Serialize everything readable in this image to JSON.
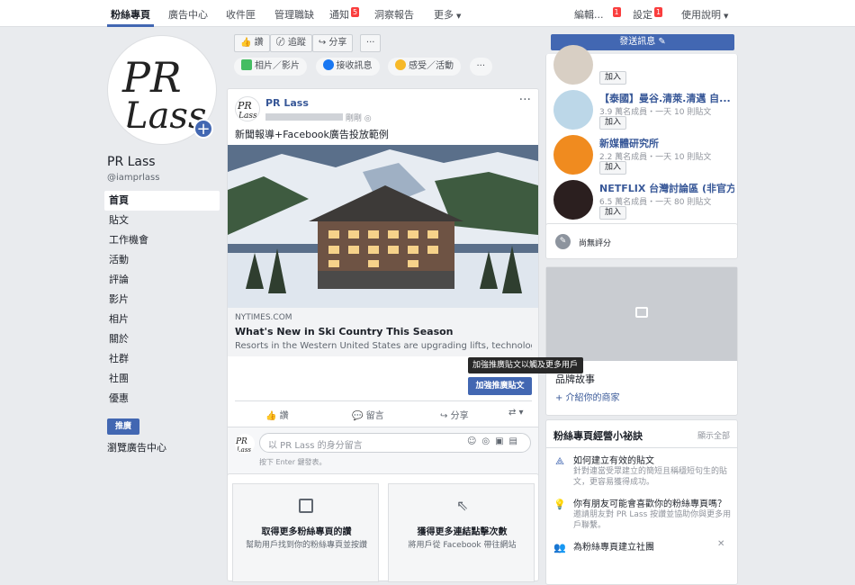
{
  "topnav": {
    "items": [
      "粉絲專頁",
      "廣告中心",
      "收件匣",
      "管理職缺",
      "通知",
      "洞察報告",
      "更多"
    ],
    "notif_badge": "5",
    "edit": "編輯...",
    "edit_badge": "1",
    "settings": "設定",
    "settings_badge": "1",
    "help": "使用說明"
  },
  "page": {
    "name": "PR Lass",
    "handle": "@iamprlass",
    "logo_text": "PR Lass"
  },
  "left_nav": [
    "首頁",
    "貼文",
    "工作機會",
    "活動",
    "評論",
    "影片",
    "相片",
    "關於",
    "社群",
    "社團",
    "優惠"
  ],
  "promote_label": "推廣",
  "ad_center": "瀏覽廣告中心",
  "actions": {
    "like": "讚",
    "follow": "追蹤",
    "share": "分享",
    "more": "···"
  },
  "composer_chips": [
    "相片／影片",
    "接收訊息",
    "感受／活動",
    "···"
  ],
  "post": {
    "author": "PR Lass",
    "time": "剛剛",
    "text": "新聞報導+Facebook廣告投放範例",
    "link_domain": "NYTIMES.COM",
    "link_title": "What's New in Ski Country This Season",
    "link_desc": "Resorts in the Western United States are upgrading lifts, technology...",
    "boost_tooltip": "加強推廣貼文以觸及更多用戶",
    "boost_button": "加強推廣貼文",
    "like": "讚",
    "comment": "留言",
    "share": "分享",
    "comment_placeholder": "以 PR Lass 的身分留言",
    "comment_hint": "按下 Enter 鍵發表。"
  },
  "promo_cards": [
    {
      "title": "取得更多粉絲專頁的讚",
      "desc": "幫助用戶找到你的粉絲專頁並按讚"
    },
    {
      "title": "獲得更多連結點擊次數",
      "desc": "將用戶從 Facebook 帶往網站"
    }
  ],
  "send_message": "發送訊息",
  "groups": [
    {
      "name": "",
      "meta": "",
      "join": "加入"
    },
    {
      "name": "【泰國】曼谷.清萊.清邁 自...",
      "meta": "3.9 萬名成員・一天 10 則貼文",
      "join": "加入"
    },
    {
      "name": "新媒體研究所",
      "meta": "2.2 萬名成員・一天 10 則貼文",
      "join": "加入"
    },
    {
      "name": "NETFLIX 台灣討論區 (非官方)",
      "meta": "6.5 萬名成員・一天 80 則貼文",
      "join": "加入"
    }
  ],
  "rating": "尚無評分",
  "brand_story": "品牌故事",
  "intro_store": "+ 介紹你的商家",
  "tips": {
    "title": "粉絲專頁經營小祕訣",
    "see_all": "顯示全部",
    "items": [
      {
        "title": "如何建立有效的貼文",
        "desc": "針對連當受眾建立的簡短且稱穩短句生的貼文，更容易獲得成功。"
      },
      {
        "title": "你有朋友可能會喜歡你的粉絲專頁嗎？",
        "desc": "邀請朋友對 PR Lass 按讚並協助你與更多用戶聯繫。"
      },
      {
        "title": "為粉絲專頁建立社團",
        "desc": ""
      }
    ]
  }
}
